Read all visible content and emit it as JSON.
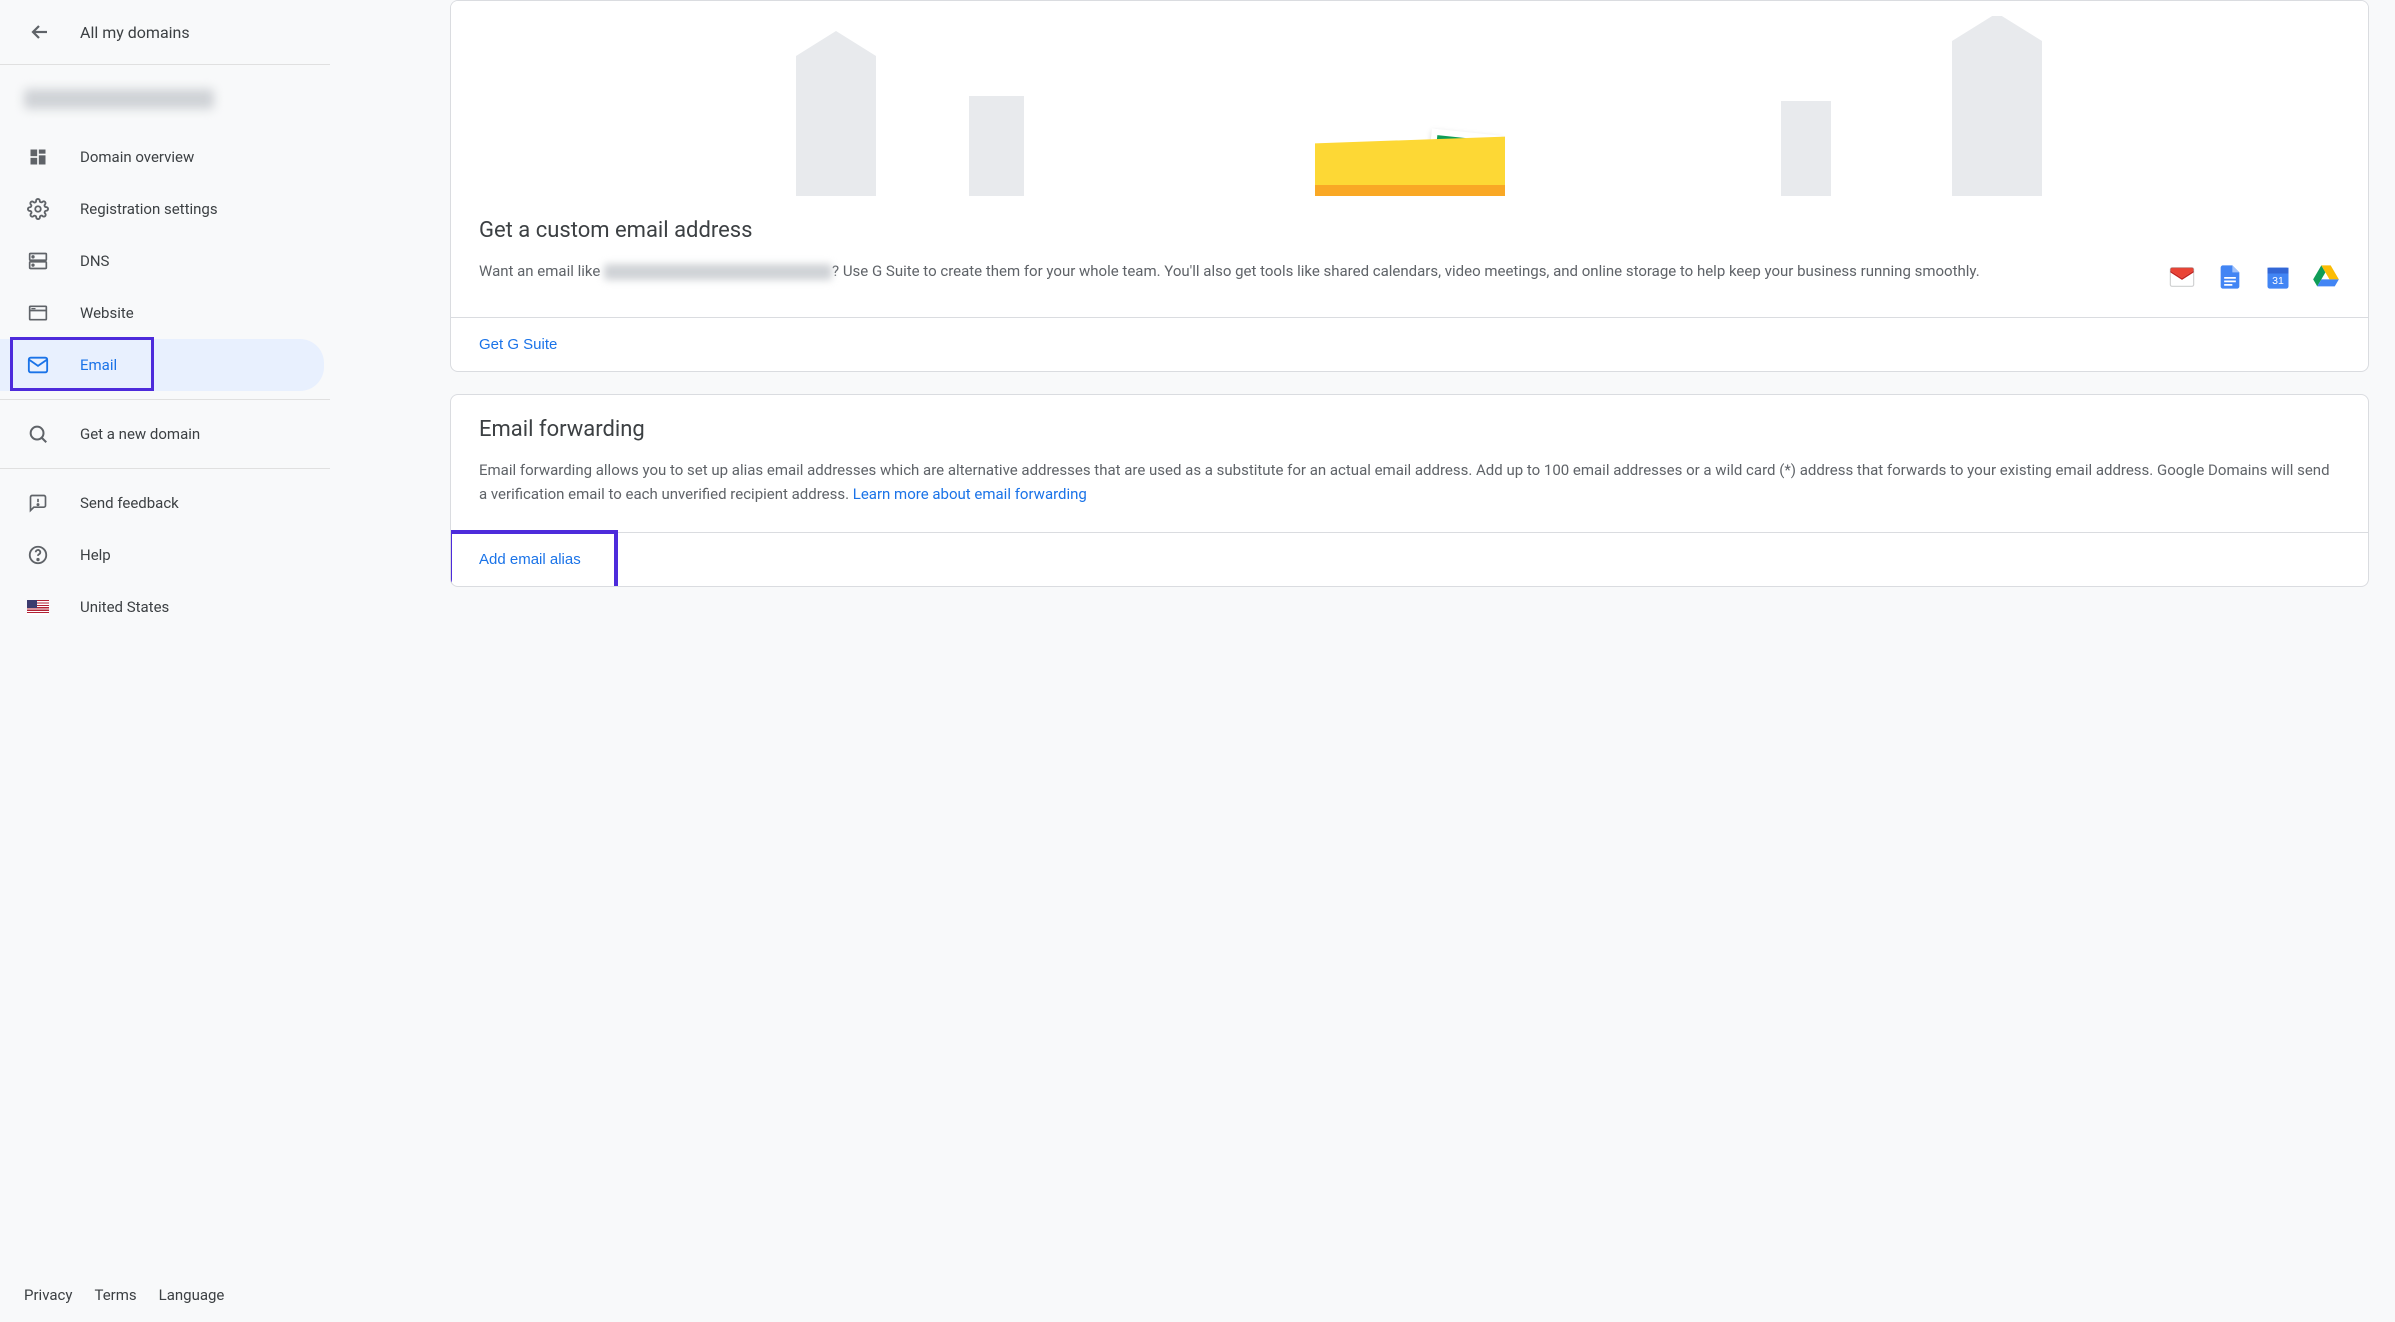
{
  "sidebar": {
    "title": "All my domains",
    "nav": [
      {
        "label": "Domain overview"
      },
      {
        "label": "Registration settings"
      },
      {
        "label": "DNS"
      },
      {
        "label": "Website"
      },
      {
        "label": "Email"
      },
      {
        "label": "Get a new domain"
      },
      {
        "label": "Send feedback"
      },
      {
        "label": "Help"
      },
      {
        "label": "United States"
      }
    ],
    "footer": {
      "privacy": "Privacy",
      "terms": "Terms",
      "language": "Language"
    }
  },
  "custom_email": {
    "title": "Get a custom email address",
    "text_prefix": "Want an email like ",
    "text_suffix": "? Use G Suite to create them for your whole team. You'll also get tools like shared calendars, video meetings, and online storage to help keep your business running smoothly.",
    "action": "Get G Suite"
  },
  "forwarding": {
    "title": "Email forwarding",
    "text": "Email forwarding allows you to set up alias email addresses which are alternative addresses that are used as a substitute for an actual email address. Add up to 100 email addresses or a wild card (*) address that forwards to your existing email address. Google Domains will send a verification email to each unverified recipient address. ",
    "learn_more": "Learn more about email forwarding",
    "action": "Add email alias"
  }
}
